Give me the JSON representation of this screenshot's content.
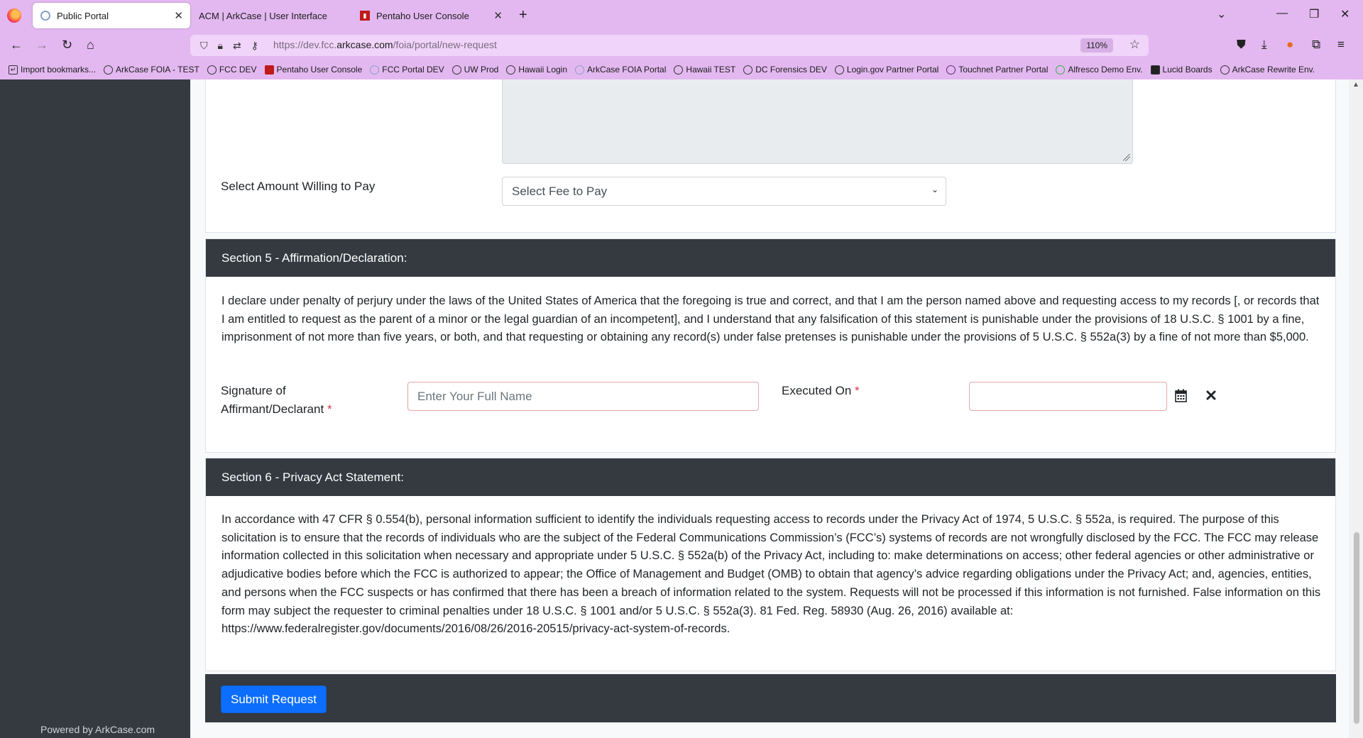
{
  "browser": {
    "tabs": [
      {
        "title": "Public Portal",
        "active": true
      },
      {
        "title": "ACM | ArkCase | User Interface",
        "active": false
      },
      {
        "title": "Pentaho User Console",
        "active": false
      }
    ],
    "url_prefix": "https://dev.fcc.",
    "url_domain": "arkcase.com",
    "url_path": "/foia/portal/new-request",
    "zoom": "110%",
    "bookmarks": [
      "Import bookmarks...",
      "ArkCase FOIA - TEST",
      "FCC DEV",
      "Pentaho User Console",
      "FCC Portal DEV",
      "UW Prod",
      "Hawaii Login",
      "ArkCase FOIA Portal",
      "Hawaii TEST",
      "DC Forensics DEV",
      "Login.gov Partner Portal",
      "Touchnet Partner Portal",
      "Alfresco Demo Env.",
      "Lucid Boards",
      "ArkCase Rewrite Env."
    ]
  },
  "sidebar": {
    "powered_by": "Powered by ArkCase.com"
  },
  "fees": {
    "label": "Select Amount Willing to Pay",
    "select_value": "Select Fee to Pay"
  },
  "section5": {
    "title": "Section 5 - Affirmation/Declaration:",
    "declaration": "I declare under penalty of perjury under the laws of the United States of America that the foregoing is true and correct, and that I am the person named above and requesting access to my records [, or records that I am entitled to request as the parent of a minor or the legal guardian of an incompetent], and I understand that any falsification of this statement is punishable under the provisions of 18 U.S.C. § 1001 by a fine, imprisonment of not more than five years, or both, and that requesting or obtaining any record(s) under false pretenses is punishable under the provisions of 5 U.S.C. § 552a(3) by a fine of not more than $5,000.",
    "signature_label_line1": "Signature of",
    "signature_label_line2": "Affirmant/Declarant",
    "signature_placeholder": "Enter Your Full Name",
    "executed_label": "Executed On",
    "required_mark": "*"
  },
  "section6": {
    "title": "Section 6 - Privacy Act Statement:",
    "statement": "In accordance with 47 CFR § 0.554(b), personal information sufficient to identify the individuals requesting access to records under the Privacy Act of 1974, 5 U.S.C. § 552a, is required. The purpose of this solicitation is to ensure that the records of individuals who are the subject of the Federal Communications Commission’s (FCC’s) systems of records are not wrongfully disclosed by the FCC. The FCC may release information collected in this solicitation when necessary and appropriate under 5 U.S.C. § 552a(b) of the Privacy Act, including to: make determinations on access; other federal agencies or other administrative or adjudicative bodies before which the FCC is authorized to appear; the Office of Management and Budget (OMB) to obtain that agency’s advice regarding obligations under the Privacy Act; and, agencies, entities, and persons when the FCC suspects or has confirmed that there has been a breach of information related to the system. Requests will not be processed if this information is not furnished. False information on this form may subject the requester to criminal penalties under 18 U.S.C. § 1001 and/or 5 U.S.C. § 552a(3). 81 Fed. Reg. 58930 (Aug. 26, 2016) available at: https://www.federalregister.gov/documents/2016/08/26/2016-20515/privacy-act-system-of-records."
  },
  "submit_label": "Submit Request"
}
